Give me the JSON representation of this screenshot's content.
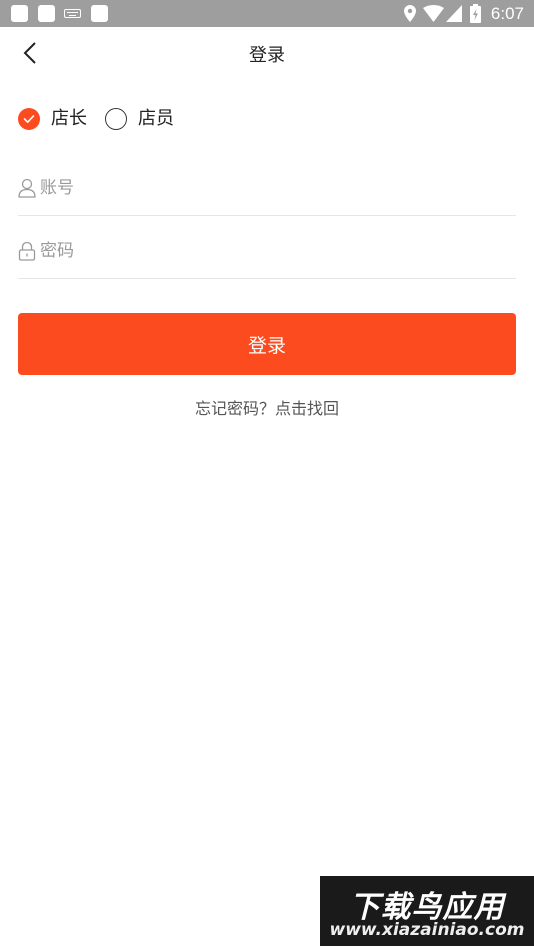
{
  "status_bar": {
    "time": "6:07"
  },
  "header": {
    "title": "登录"
  },
  "roles": [
    {
      "label": "店长",
      "selected": true
    },
    {
      "label": "店员",
      "selected": false
    }
  ],
  "account_field": {
    "placeholder": "账号",
    "value": ""
  },
  "password_field": {
    "placeholder": "密码",
    "value": ""
  },
  "login_button": {
    "label": "登录"
  },
  "forgot_link": {
    "label": "忘记密码？点击找回"
  },
  "watermark": {
    "title": "下载鸟应用",
    "url": "www.xiazainiao.com"
  },
  "colors": {
    "accent": "#fb4b1f",
    "status_bar": "#9e9e9e",
    "divider": "#e6e6e6"
  }
}
